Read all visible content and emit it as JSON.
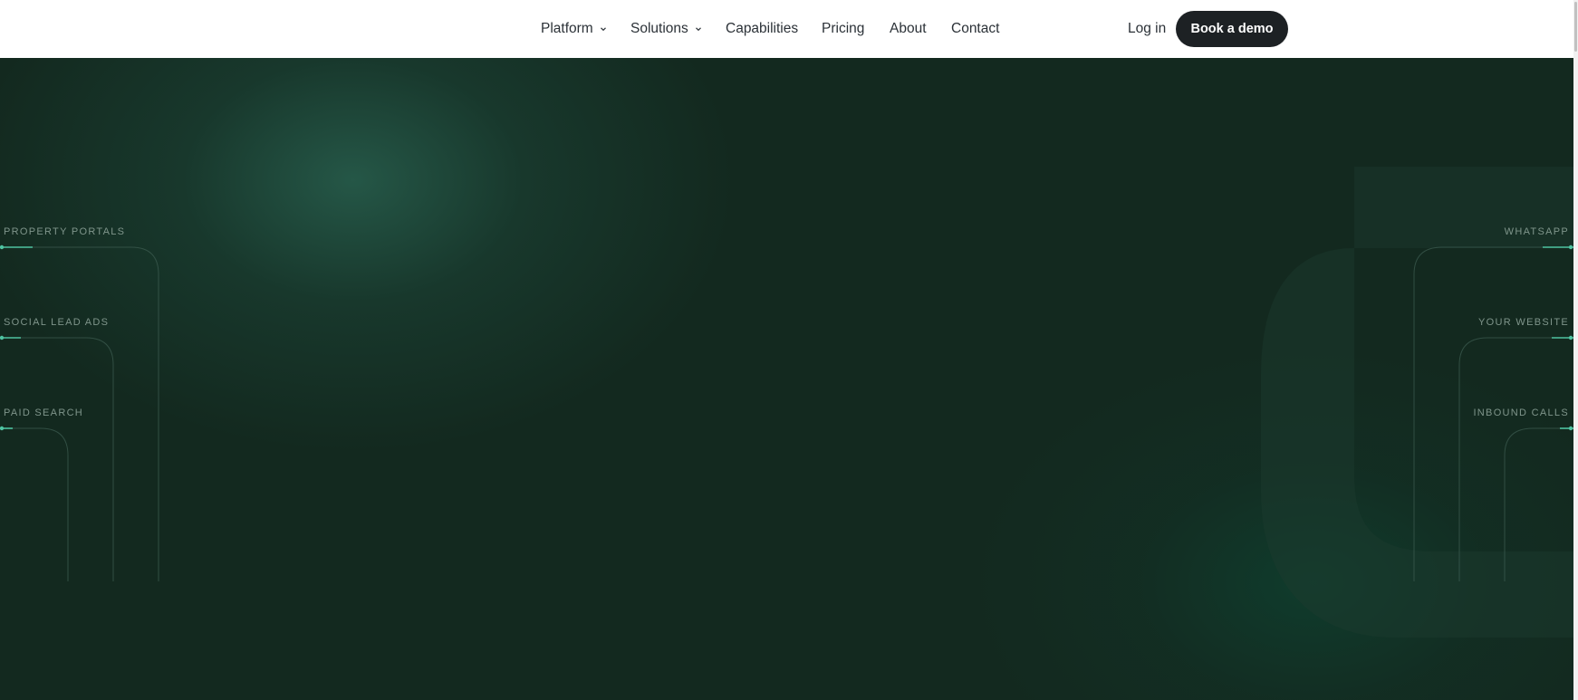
{
  "nav": {
    "items": [
      {
        "label": "Platform",
        "has_dropdown": true
      },
      {
        "label": "Solutions",
        "has_dropdown": true
      },
      {
        "label": "Capabilities",
        "has_dropdown": false
      },
      {
        "label": "Pricing",
        "has_dropdown": false
      },
      {
        "label": "About",
        "has_dropdown": false
      },
      {
        "label": "Contact",
        "has_dropdown": false
      }
    ],
    "login_label": "Log in",
    "cta_label": "Book a demo"
  },
  "hero": {
    "left_sources": [
      "PROPERTY PORTALS",
      "SOCIAL LEAD ADS",
      "PAID SEARCH"
    ],
    "right_sources": [
      "WHATSAPP",
      "YOUR WEBSITE",
      "INBOUND CALLS"
    ]
  },
  "colors": {
    "background": "#13291f",
    "accent": "#4fc3a1",
    "cta_bg": "#1d2124",
    "label": "#7f958b"
  },
  "icons": {
    "dropdown": "chevron-down-icon"
  }
}
